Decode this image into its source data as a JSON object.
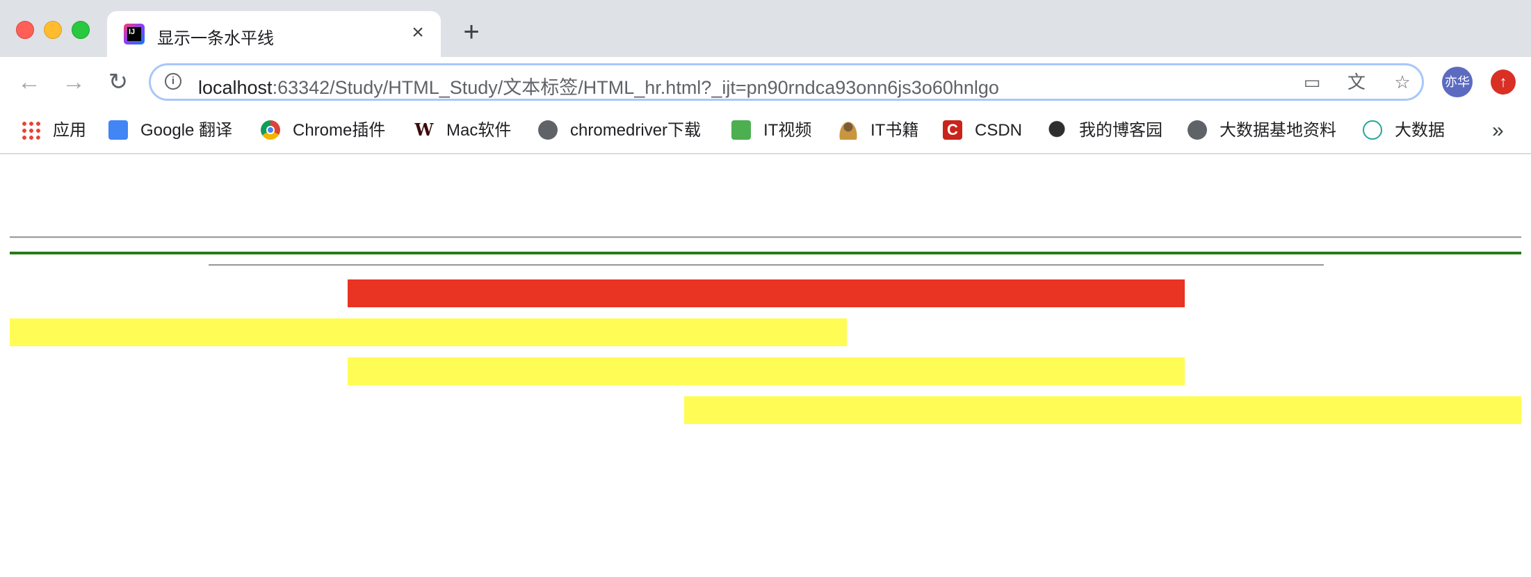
{
  "browser": {
    "tab": {
      "title": "显示一条水平线",
      "favicon": "intellij-icon",
      "close_icon": "×"
    },
    "new_tab_icon": "+",
    "nav": {
      "back_icon": "←",
      "forward_icon": "→",
      "reload_icon": "↻"
    },
    "address_bar": {
      "info_icon": "i",
      "host": "localhost",
      "path": ":63342/Study/HTML_Study/文本标签/HTML_hr.html?_ijt=pn90rndca93onn6js3o60hnlgo"
    },
    "omnibox_icons": {
      "cast": "▭",
      "translate": "文",
      "star": "☆"
    },
    "profile": {
      "avatar_label": "亦华"
    },
    "update_icon": "↑"
  },
  "bookmarks": {
    "items": [
      {
        "label": "应用",
        "icon": "apps-grid-icon"
      },
      {
        "label": "Google 翻译",
        "icon": "google-translate-icon"
      },
      {
        "label": "Chrome插件",
        "icon": "chrome-icon"
      },
      {
        "label": "Mac软件",
        "icon": "mac-software-icon"
      },
      {
        "label": "chromedriver下载",
        "icon": "globe-icon"
      },
      {
        "label": "IT视频",
        "icon": "it-video-icon"
      },
      {
        "label": "IT书籍",
        "icon": "it-book-icon"
      },
      {
        "label": "CSDN",
        "icon": "csdn-icon"
      },
      {
        "label": "我的博客园",
        "icon": "blog-icon"
      },
      {
        "label": "大数据基地资料",
        "icon": "globe-icon"
      },
      {
        "label": "大数据",
        "icon": "network-icon"
      }
    ],
    "more_label": "»"
  },
  "page": {
    "rules": [
      {
        "name": "default",
        "color": "#9a9a9a"
      },
      {
        "name": "green",
        "color": "#2a7a1a"
      },
      {
        "name": "centered",
        "color": "#9a9a9a"
      },
      {
        "name": "red-center",
        "color": "#e93323"
      },
      {
        "name": "yellow-left",
        "color": "#fffc55"
      },
      {
        "name": "yellow-center",
        "color": "#fffc55"
      },
      {
        "name": "yellow-right",
        "color": "#fffc55"
      }
    ]
  }
}
